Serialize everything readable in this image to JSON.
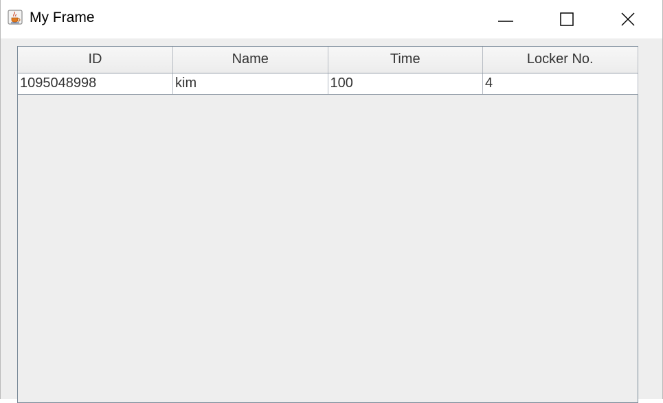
{
  "window": {
    "title": "My Frame",
    "app_icon": "java-coffee-cup-icon",
    "controls": {
      "minimize_icon": "minimize-icon",
      "maximize_icon": "maximize-icon",
      "close_icon": "close-icon"
    }
  },
  "table": {
    "columns": [
      "ID",
      "Name",
      "Time",
      "Locker No."
    ],
    "rows": [
      [
        "1095048998",
        "kim",
        "100",
        "4"
      ]
    ]
  },
  "colors": {
    "content_bg": "#eeeeee",
    "titlebar_bg": "#ffffff",
    "grid_line": "#8f9aa5"
  }
}
